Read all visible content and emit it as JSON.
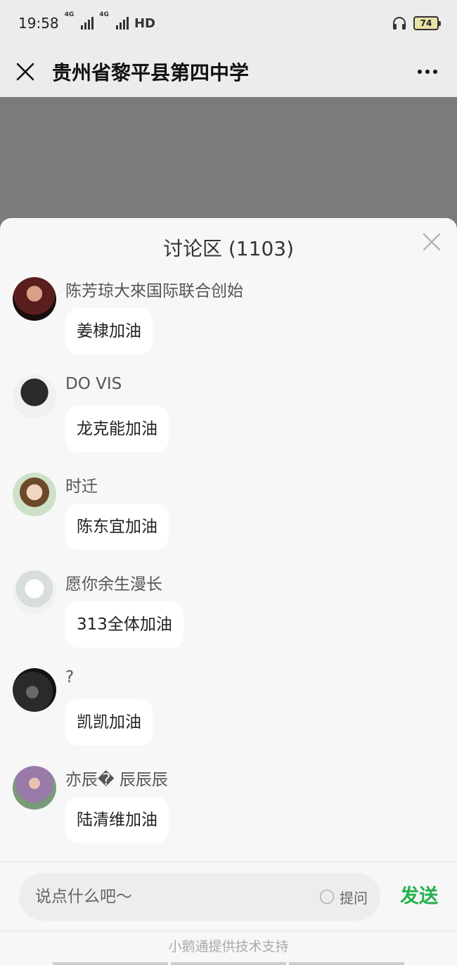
{
  "status_bar": {
    "time": "19:58",
    "network_1": "4G",
    "network_2": "4G",
    "hd": "HD",
    "battery": "74",
    "headset_icon": "headset-icon"
  },
  "header": {
    "title": "贵州省黎平县第四中学",
    "close_icon": "close-icon",
    "more_icon": "more-icon"
  },
  "discussion": {
    "title": "讨论区 (1103)",
    "close_icon": "close-icon",
    "comments": [
      {
        "user": "陈芳琼大來国际联合创始",
        "message": "姜棣加油",
        "avatar_color": "#3a1a1a"
      },
      {
        "user": "DO VIS",
        "message": "龙克能加油",
        "avatar_color": "#1b1b1b"
      },
      {
        "user": "时迁",
        "message": "陈东宜加油",
        "avatar_color": "#c9b79a"
      },
      {
        "user": "愿你余生漫长",
        "message": "313全体加油",
        "avatar_color": "#e8ebe9"
      },
      {
        "user": "?",
        "message": "凯凯加油",
        "avatar_color": "#2a2a2a"
      },
      {
        "user": "亦辰� 辰辰辰",
        "message": "陆清维加油",
        "avatar_color": "#8a6a8a"
      }
    ]
  },
  "input_bar": {
    "placeholder": "说点什么吧～",
    "ask_label": "提问",
    "send_label": "发送"
  },
  "footer": {
    "text": "小鹅通提供技术支持"
  },
  "colors": {
    "accent_green": "#22b14c",
    "bg_gray": "#7b7b7b",
    "sheet_bg": "#f7f7f7"
  }
}
